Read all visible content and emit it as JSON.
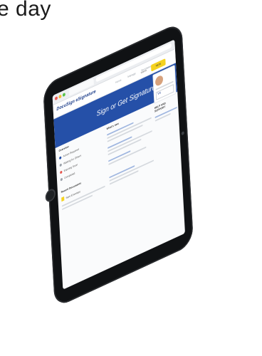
{
  "headline": "e day",
  "browser": {
    "tab_label": "",
    "url": ""
  },
  "app": {
    "logo": "DocuSign eSignature",
    "nav": [
      "Home",
      "Manage",
      "Templates",
      "Reports"
    ],
    "home_link": "Home",
    "new_button": "NEW",
    "banner_title": "Sign or Get Signatures"
  },
  "left": {
    "heading": "Overview",
    "items": [
      {
        "label": "Action Required",
        "color": "#2550a8"
      },
      {
        "label": "Waiting for Others",
        "color": "#9aa1a9"
      },
      {
        "label": "Expiring Soon",
        "color": "#e5534b"
      },
      {
        "label": "Completed",
        "color": "#9aa1a9"
      }
    ],
    "docs_heading": "Recent Documents",
    "doc_label": "Sent Envelope"
  },
  "mid": {
    "heading": "What's new"
  },
  "right": {
    "signature": "Vu",
    "side_heading": "HELP AND SUPPORT"
  },
  "colors": {
    "brand": "#2550a8",
    "accent": "#f5d21f"
  }
}
